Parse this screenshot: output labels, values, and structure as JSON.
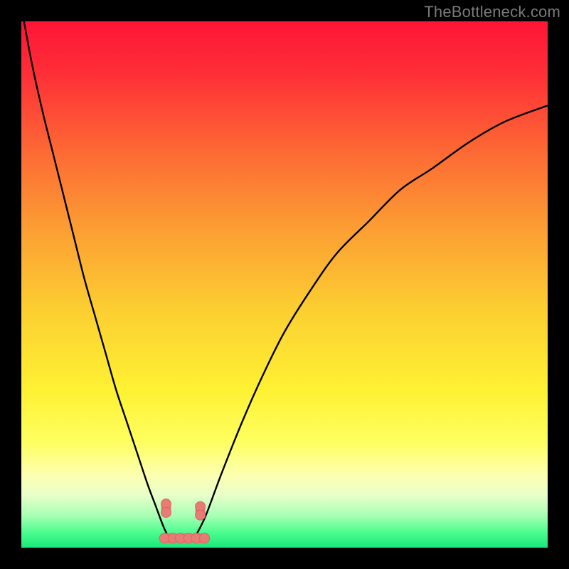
{
  "watermark": "TheBottleneck.com",
  "colors": {
    "background": "#000000",
    "gradient_stops": [
      {
        "offset": 0.0,
        "color": "#fe1537"
      },
      {
        "offset": 0.1,
        "color": "#fe2f37"
      },
      {
        "offset": 0.25,
        "color": "#fd6a34"
      },
      {
        "offset": 0.4,
        "color": "#fca033"
      },
      {
        "offset": 0.55,
        "color": "#fccf31"
      },
      {
        "offset": 0.7,
        "color": "#fef133"
      },
      {
        "offset": 0.8,
        "color": "#feff60"
      },
      {
        "offset": 0.86,
        "color": "#fdffae"
      },
      {
        "offset": 0.9,
        "color": "#e9ffc9"
      },
      {
        "offset": 0.94,
        "color": "#a6ffb4"
      },
      {
        "offset": 0.97,
        "color": "#4efd90"
      },
      {
        "offset": 1.0,
        "color": "#19e879"
      }
    ],
    "curve_stroke": "#000000",
    "marker_fill": "#e77c77",
    "marker_stroke": "#de635f"
  },
  "chart_data": {
    "type": "line",
    "title": "",
    "xlabel": "",
    "ylabel": "",
    "xlim": [
      0,
      100
    ],
    "ylim": [
      0,
      100
    ],
    "series": [
      {
        "name": "left-curve",
        "x": [
          0.5,
          2,
          4,
          6,
          8,
          10,
          12,
          14,
          16,
          18,
          20,
          22,
          24,
          25.5,
          27,
          28
        ],
        "y": [
          100,
          92,
          83,
          75,
          67,
          59,
          51,
          44,
          37,
          30,
          24,
          18,
          12,
          8,
          4,
          2
        ]
      },
      {
        "name": "right-curve",
        "x": [
          33,
          35,
          38,
          42,
          46,
          50,
          55,
          60,
          66,
          72,
          78,
          85,
          92,
          100
        ],
        "y": [
          2,
          6,
          14,
          24,
          33,
          41,
          49,
          56,
          62,
          68,
          72,
          77,
          81,
          84
        ]
      }
    ],
    "markers": [
      {
        "name": "left-pair",
        "x": 27.5,
        "y": 7.5
      },
      {
        "name": "right-pair",
        "x": 34.0,
        "y": 7.0
      },
      {
        "name": "bottom-left",
        "x": 28.0,
        "y": 1.8
      },
      {
        "name": "bottom-mid",
        "x": 31.0,
        "y": 1.8
      },
      {
        "name": "bottom-right",
        "x": 34.0,
        "y": 1.8
      }
    ]
  }
}
